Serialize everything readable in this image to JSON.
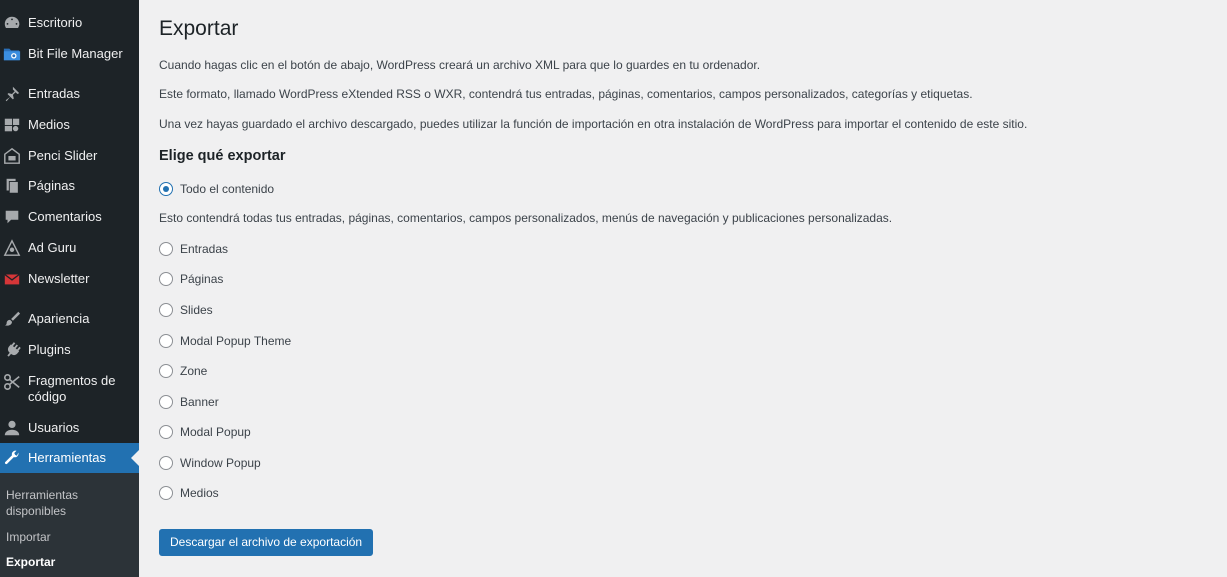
{
  "colors": {
    "sidebar_bg": "#1d2327",
    "accent": "#2271b1",
    "page_bg": "#f0f0f1"
  },
  "sidebar": {
    "items": [
      {
        "label": "Escritorio",
        "icon": "dashboard-icon"
      },
      {
        "label": "Bit File Manager",
        "icon": "folder-icon"
      },
      {
        "label": "Entradas",
        "icon": "pushpin-icon"
      },
      {
        "label": "Medios",
        "icon": "media-icon"
      },
      {
        "label": "Penci Slider",
        "icon": "slider-icon"
      },
      {
        "label": "Páginas",
        "icon": "pages-icon"
      },
      {
        "label": "Comentarios",
        "icon": "comment-icon"
      },
      {
        "label": "Ad Guru",
        "icon": "megaphone-icon"
      },
      {
        "label": "Newsletter",
        "icon": "envelope-icon"
      },
      {
        "label": "Apariencia",
        "icon": "paintbrush-icon"
      },
      {
        "label": "Plugins",
        "icon": "plugin-icon"
      },
      {
        "label": "Fragmentos de código",
        "icon": "scissors-icon"
      },
      {
        "label": "Usuarios",
        "icon": "user-icon"
      },
      {
        "label": "Herramientas",
        "icon": "wrench-icon"
      }
    ],
    "submenu": [
      {
        "label": "Herramientas disponibles"
      },
      {
        "label": "Importar"
      },
      {
        "label": "Exportar"
      }
    ]
  },
  "main": {
    "title": "Exportar",
    "intro": [
      "Cuando hagas clic en el botón de abajo, WordPress creará un archivo XML para que lo guardes en tu ordenador.",
      "Este formato, llamado WordPress eXtended RSS o WXR, contendrá tus entradas, páginas, comentarios, campos personalizados, categorías y etiquetas.",
      "Una vez hayas guardado el archivo descargado, puedes utilizar la función de importación en otra instalación de WordPress para importar el contenido de este sitio."
    ],
    "section_title": "Elige qué exportar",
    "all_content": {
      "label": "Todo el contenido",
      "description": "Esto contendrá todas tus entradas, páginas, comentarios, campos personalizados, menús de navegación y publicaciones personalizadas."
    },
    "options": [
      {
        "label": "Entradas"
      },
      {
        "label": "Páginas"
      },
      {
        "label": "Slides"
      },
      {
        "label": "Modal Popup Theme"
      },
      {
        "label": "Zone"
      },
      {
        "label": "Banner"
      },
      {
        "label": "Modal Popup"
      },
      {
        "label": "Window Popup"
      },
      {
        "label": "Medios"
      }
    ],
    "download_button": "Descargar el archivo de exportación"
  }
}
